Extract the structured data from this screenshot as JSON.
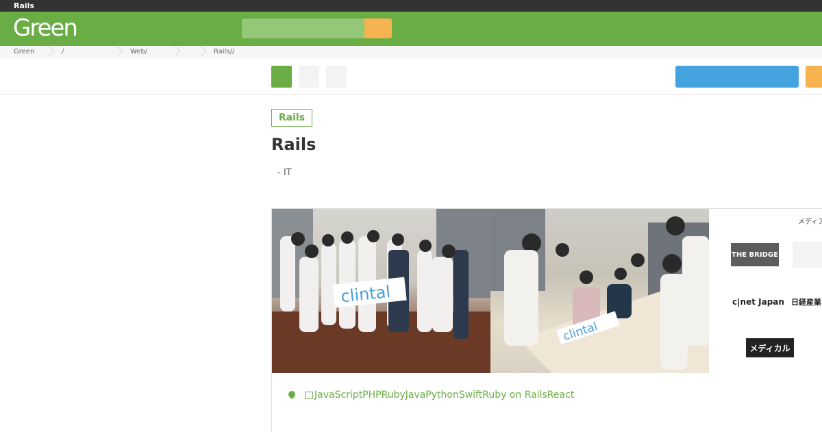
{
  "window": {
    "title": "Rails"
  },
  "header": {
    "logo": "Green",
    "search": {
      "value": "",
      "placeholder": ""
    },
    "brand_color": "#6aad45",
    "accent_color": "#f7b350"
  },
  "breadcrumb": {
    "items": [
      "Green",
      "/",
      "Web/",
      "Rails//"
    ]
  },
  "toolbar": {
    "colors": {
      "primary": "#44a3df",
      "secondary": "#f7b350"
    }
  },
  "job": {
    "tag": "Rails",
    "title": "Rails",
    "subtitle": "- IT",
    "tech_stack": "JavaScriptPHPRubyJavaPythonSwiftRuby on RailsReact"
  },
  "gallery": {
    "banner_text": "clintal",
    "media_label": "メディア",
    "media_logos": [
      "THE BRIDGE",
      "c|net Japan",
      "日経産業",
      "メディカル"
    ]
  }
}
